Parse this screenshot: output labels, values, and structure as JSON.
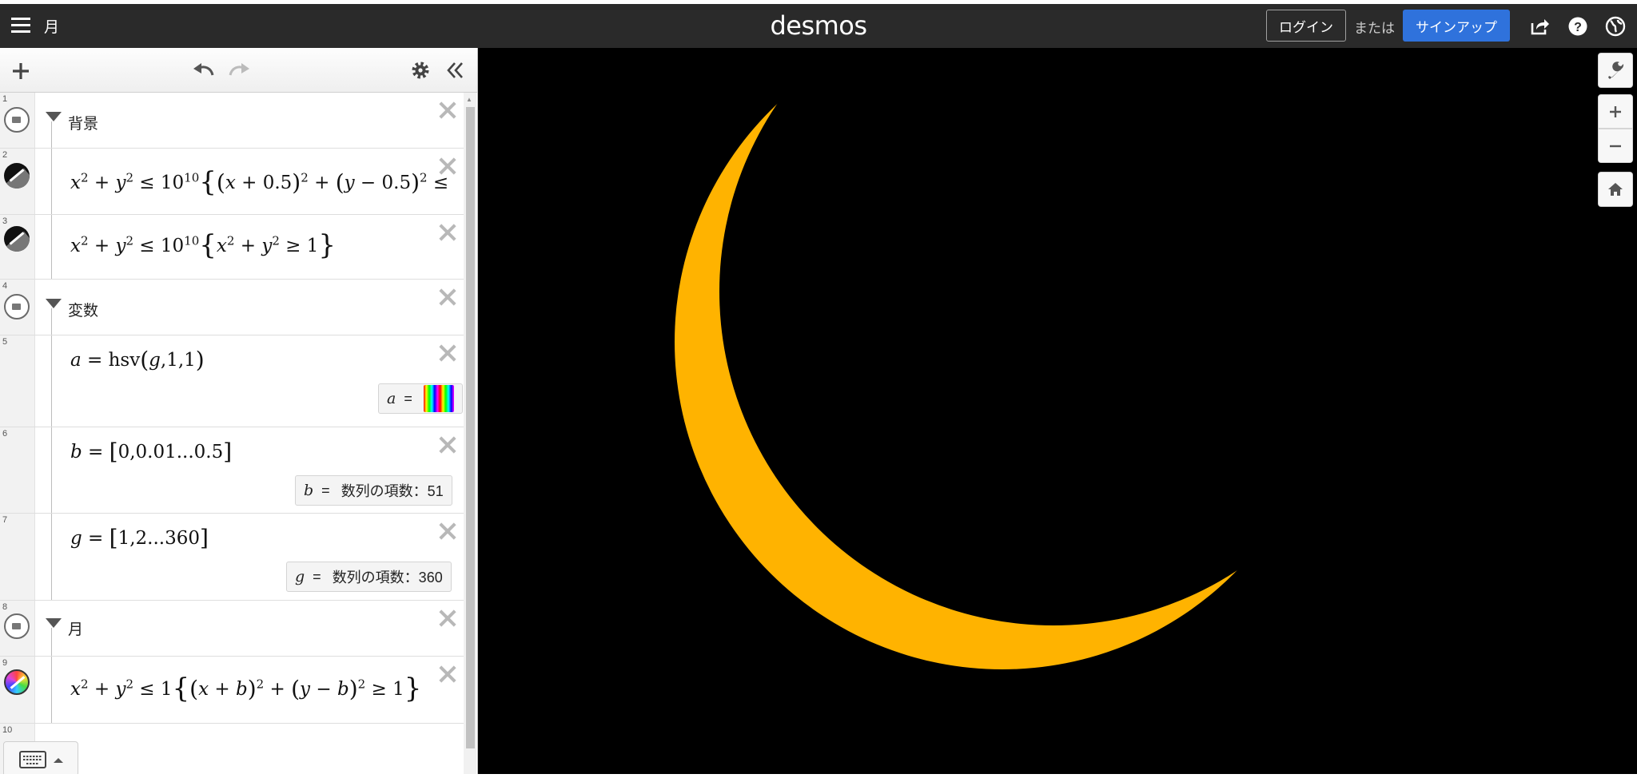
{
  "app": {
    "graph_title": "月",
    "logo": "desmos",
    "login_label": "ログイン",
    "or_label": "または",
    "signup_label": "サインアップ"
  },
  "colors": {
    "topbar": "#2a2a2a",
    "signup_button": "#2f72dc",
    "graph_background": "#000000",
    "moon_gradient": [
      "#ffb300",
      "#ffc940",
      "#ffffff"
    ]
  },
  "icons": {
    "topbar": [
      "menu-icon",
      "share-icon",
      "help-icon",
      "language-icon"
    ],
    "panel_toolbar": [
      "add-icon",
      "undo-icon",
      "redo-icon",
      "settings-icon",
      "collapse-panel-icon"
    ],
    "graph_controls": [
      "wrench-icon",
      "zoom-in-icon",
      "zoom-out-icon",
      "home-icon"
    ]
  },
  "expressions": [
    {
      "num": "1",
      "type": "folder",
      "label": "背景"
    },
    {
      "num": "2",
      "type": "expression",
      "latex": "x^2+y^2 ≤ 10^10 {(x+0.5)^2 + (y-0.5)^2 ≤"
    },
    {
      "num": "3",
      "type": "expression",
      "latex": "x^2+y^2 ≤ 10^10 {x^2+y^2 ≥ 1}"
    },
    {
      "num": "4",
      "type": "folder",
      "label": "変数"
    },
    {
      "num": "5",
      "type": "expression",
      "latex": "a = hsv(g,1,1)",
      "value_var": "a",
      "value_type": "color-list"
    },
    {
      "num": "6",
      "type": "expression",
      "latex": "b = [0,0.01...0.5]",
      "value_var": "b",
      "value_text": "数列の項数：51"
    },
    {
      "num": "7",
      "type": "expression",
      "latex": "g = [1,2...360]",
      "value_var": "g",
      "value_text": "数列の項数：360"
    },
    {
      "num": "8",
      "type": "folder",
      "label": "月"
    },
    {
      "num": "9",
      "type": "expression",
      "latex": "x^2+y^2 ≤ 1 {(x+b)^2 + (y-b)^2 ≥ 1}"
    },
    {
      "num": "10",
      "type": "empty"
    }
  ],
  "graph_content": "crescent-moon"
}
